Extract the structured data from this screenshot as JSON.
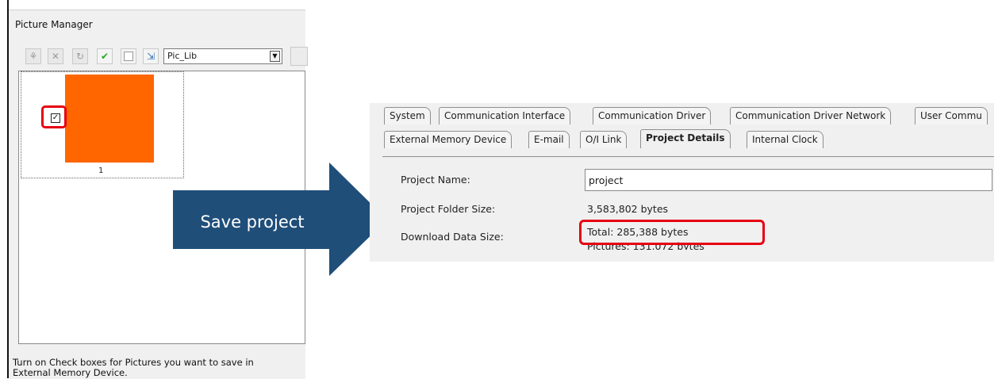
{
  "picture_manager": {
    "title": "Picture Manager",
    "toolbar": {
      "buttons": [
        "import-icon",
        "delete-icon",
        "refresh-icon",
        "check-icon",
        "uncheck-icon",
        "export-icon"
      ],
      "library_select": "Pic_Lib"
    },
    "picture": {
      "number": "1",
      "checked": true,
      "color": "#ff6600"
    },
    "hint": "Turn on Check boxes for Pictures you want to save in External Memory Device."
  },
  "arrow": {
    "label": "Save project",
    "color": "#1f4e79"
  },
  "project_settings": {
    "tabs_row1": [
      "System",
      "Communication Interface",
      "Communication Driver",
      "Communication Driver Network",
      "User Commu"
    ],
    "tabs_row2": [
      "External Memory Device",
      "E-mail",
      "O/I Link",
      "Project Details",
      "Internal Clock"
    ],
    "active_tab": "Project Details",
    "project_name_label": "Project Name:",
    "project_name_value": "project",
    "folder_size_label": "Project Folder Size:",
    "folder_size_value": "3,583,802 bytes",
    "download_size_label": "Download Data Size:",
    "download_total": "Total: 285,388 bytes",
    "download_pictures": "Pictures: 131,072 bytes"
  },
  "highlight_color": "#e60012"
}
